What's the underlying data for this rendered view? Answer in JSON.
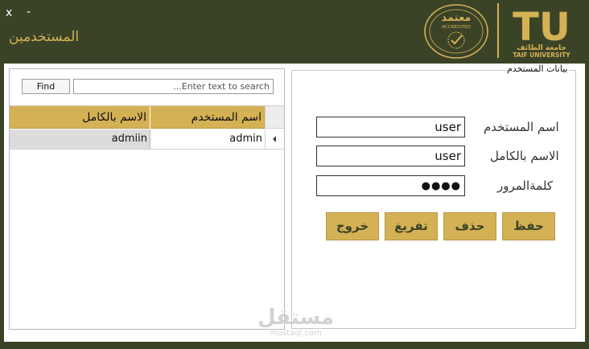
{
  "window": {
    "close_label": "x",
    "minimize_label": "-",
    "title": "المستخدمين"
  },
  "logos": {
    "seal_text_ar": "معتمد",
    "seal_text_en": "ACCREDITED",
    "tu_letters": "TU",
    "tu_name_ar": "جامعة الطائف",
    "tu_name_en": "TAIF UNIVERSITY"
  },
  "search": {
    "find_label": "Find",
    "placeholder": "Enter text to search..."
  },
  "grid": {
    "columns": [
      "اسم المستخدم",
      "الاسم بالكامل"
    ],
    "rows": [
      {
        "username": "admin",
        "fullname": "admiin"
      }
    ]
  },
  "form": {
    "group_title": "بيانات المستخدم",
    "username_label": "اسم المستخدم",
    "fullname_label": "الاسم بالكامل",
    "password_label": "كلمةالمرور",
    "username_value": "user",
    "fullname_value": "user",
    "password_value": "●●●●"
  },
  "buttons": {
    "save": "حفظ",
    "delete": "حذف",
    "clear": "تفريغ",
    "exit": "خروج"
  },
  "watermark": {
    "ar": "مستقل",
    "en": "mostaql.com"
  },
  "colors": {
    "frame": "#3b4327",
    "accent": "#d4b155"
  }
}
